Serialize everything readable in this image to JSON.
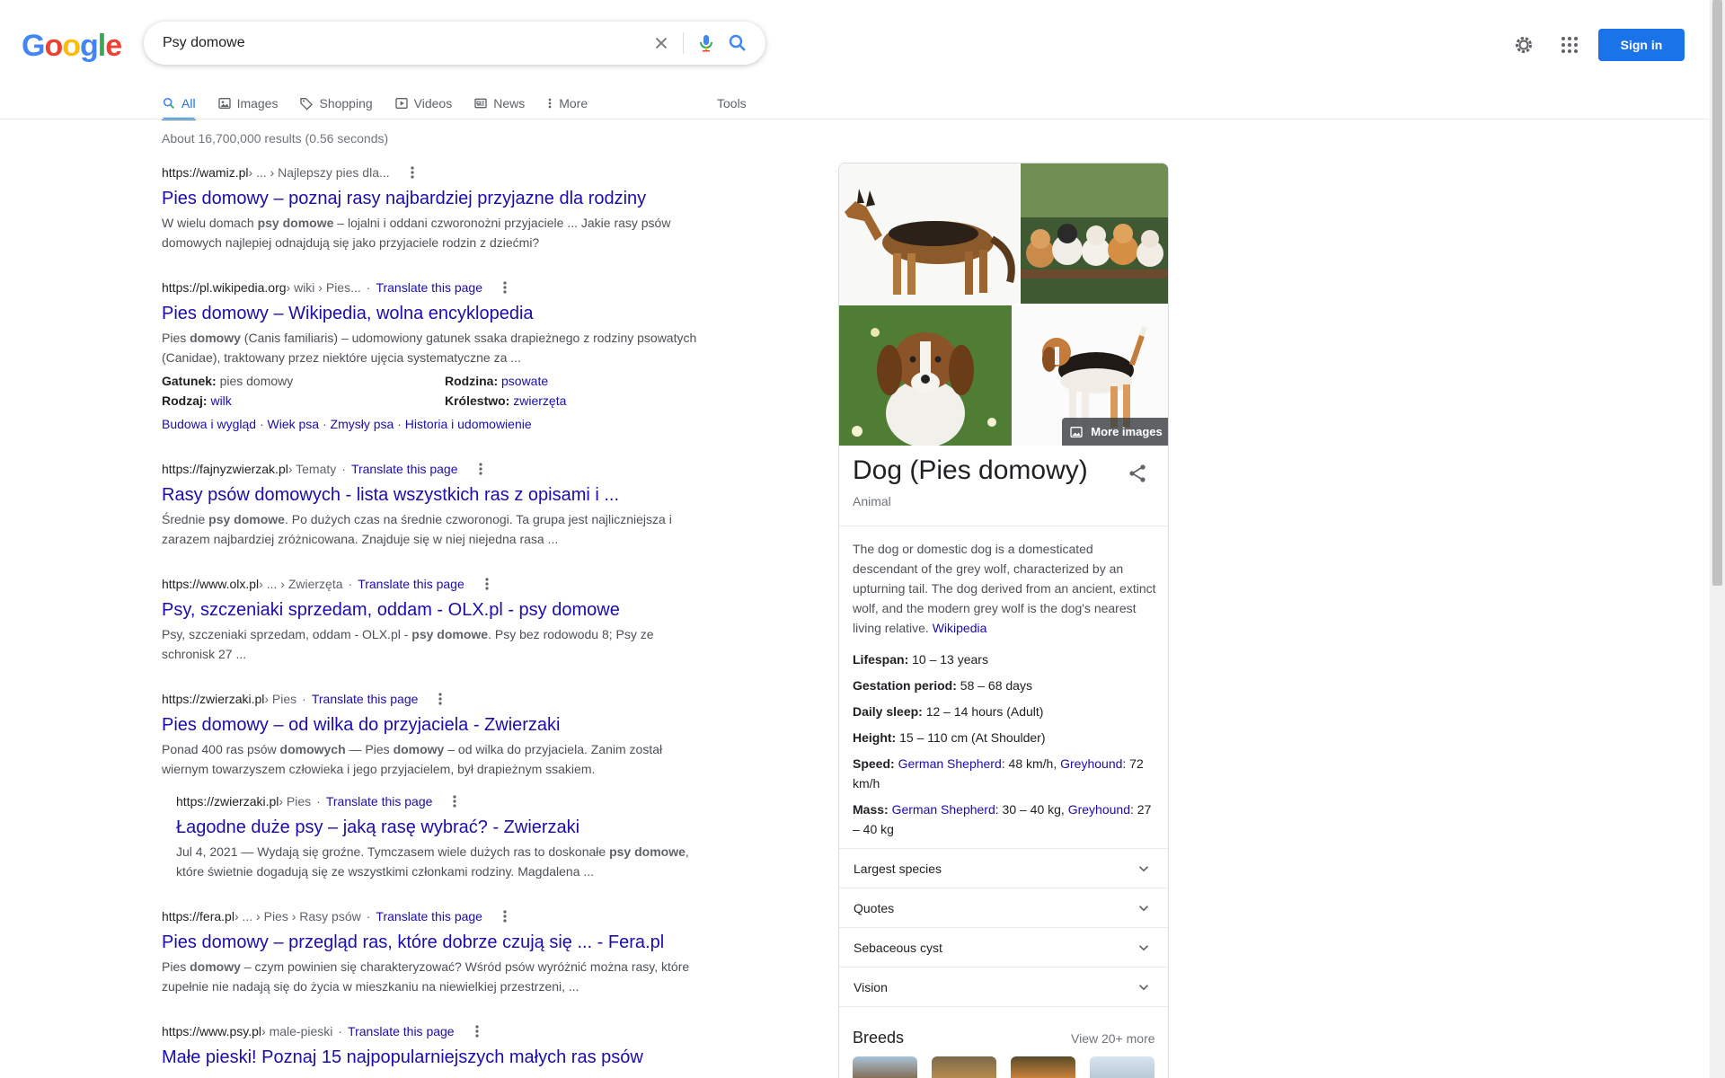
{
  "logo": {
    "letters": [
      "G",
      "o",
      "o",
      "g",
      "l",
      "e"
    ]
  },
  "search": {
    "query": "Psy domowe"
  },
  "header": {
    "sign_in": "Sign in"
  },
  "tabs": [
    {
      "label": "All",
      "icon": "search-icon",
      "active": true
    },
    {
      "label": "Images",
      "icon": "image-icon"
    },
    {
      "label": "Shopping",
      "icon": "tag-icon"
    },
    {
      "label": "Videos",
      "icon": "play-icon"
    },
    {
      "label": "News",
      "icon": "news-icon"
    },
    {
      "label": "More",
      "icon": "more-vert-icon"
    }
  ],
  "tools": "Tools",
  "stats": "About 16,700,000 results (0.56 seconds)",
  "results": [
    {
      "url": "https://wamiz.pl",
      "path": " › ... › Najlepszy pies dla...",
      "translate": "",
      "title": "Pies domowy – poznaj rasy najbardziej przyjazne dla rodziny",
      "snippet_parts": [
        "W wielu domach ",
        "psy domowe",
        " – lojalni i oddani czworonożni przyjaciele ... Jakie rasy psów domowych najlepiej odnajdują się jako przyjaciele rodzin z dziećmi?"
      ]
    },
    {
      "url": "https://pl.wikipedia.org",
      "path": " › wiki › Pies...",
      "translate": "Translate this page",
      "title": "Pies domowy – Wikipedia, wolna encyklopedia",
      "snippet_parts": [
        "Pies ",
        "domowy",
        " (Canis familiaris) – udomowiony gatunek ssaka drapieżnego z rodziny psowatych (Canidae), traktowany przez niektóre ujęcia systematyczne za ..."
      ],
      "attrs": [
        {
          "label": "Gatunek:",
          "value": "pies domowy",
          "link": false
        },
        {
          "label": "Rodzina:",
          "value": "psowate",
          "link": true
        },
        {
          "label": "Rodzaj:",
          "value": "wilk",
          "link": true
        },
        {
          "label": "Królestwo:",
          "value": "zwierzęta",
          "link": true
        }
      ],
      "sitelinks": [
        "Budowa i wygląd",
        "Wiek psa",
        "Zmysły psa",
        "Historia i udomowienie"
      ]
    },
    {
      "url": "https://fajnyzwierzak.pl",
      "path": " › Tematy",
      "translate": "Translate this page",
      "title": "Rasy psów domowych - lista wszystkich ras z opisami i ...",
      "snippet_parts": [
        "Średnie ",
        "psy domowe",
        ". Po dużych czas na średnie czworonogi. Ta grupa jest najliczniejsza i zarazem najbardziej zróżnicowana. Znajduje się w niej niejedna rasa ..."
      ]
    },
    {
      "url": "https://www.olx.pl",
      "path": " › ... › Zwierzęta",
      "translate": "Translate this page",
      "title": "Psy, szczeniaki sprzedam, oddam - OLX.pl - psy domowe",
      "snippet_parts": [
        "Psy, szczeniaki sprzedam, oddam - OLX.pl - ",
        "psy domowe",
        ". Psy bez rodowodu 8; Psy ze schronisk 27 ..."
      ]
    },
    {
      "url": "https://zwierzaki.pl",
      "path": " › Pies",
      "translate": "Translate this page",
      "title": "Pies domowy – od wilka do przyjaciela - Zwierzaki",
      "snippet_parts": [
        "Ponad 400 ras psów ",
        "domowych",
        " — Pies ",
        "domowy",
        " – od wilka do przyjaciela. Zanim został wiernym towarzyszem człowieka i jego przyjacielem, był drapieżnym ssakiem."
      ],
      "sub": {
        "url": "https://zwierzaki.pl",
        "path": " › Pies",
        "translate": "Translate this page",
        "title": "Łagodne duże psy – jaką rasę wybrać? - Zwierzaki",
        "snippet_parts": [
          "Jul 4, 2021 — Wydają się groźne. Tymczasem wiele dużych ras to doskonałe ",
          "psy domowe",
          ", które świetnie dogadują się ze wszystkimi członkami rodziny. Magdalena ..."
        ]
      }
    },
    {
      "url": "https://fera.pl",
      "path": " › ... › Pies › Rasy psów",
      "translate": "Translate this page",
      "title": "Pies domowy – przegląd ras, które dobrze czują się ... - Fera.pl",
      "snippet_parts": [
        "Pies ",
        "domowy",
        " – czym powinien się charakteryzować? Wśród psów wyróżnić można rasy, które zupełnie nie nadają się do życia w mieszkaniu na niewielkiej przestrzeni, ..."
      ]
    },
    {
      "url": "https://www.psy.pl",
      "path": " › male-pieski",
      "translate": "Translate this page",
      "title": "Małe pieski! Poznaj 15 najpopularniejszych małych ras psów",
      "snippet_parts": [
        "",
        "",
        ""
      ]
    }
  ],
  "knowledge_panel": {
    "more_images": "More images",
    "title": "Dog (Pies domowy)",
    "subtitle": "Animal",
    "description": "The dog or domestic dog is a domesticated descendant of the grey wolf, characterized by an upturning tail. The dog derived from an ancient, extinct wolf, and the modern grey wolf is the dog's nearest living relative. ",
    "description_link": "Wikipedia",
    "facts": {
      "lifespan_label": "Lifespan:",
      "lifespan": " 10 – 13 years",
      "gestation_label": "Gestation period:",
      "gestation": " 58 – 68 days",
      "sleep_label": "Daily sleep:",
      "sleep": " 12 – 14 hours (Adult)",
      "height_label": "Height:",
      "height": " 15 – 110 cm (At Shoulder)",
      "speed_label": "Speed:",
      "speed_l1": "German Shepherd",
      "speed_v1": ": 48 km/h, ",
      "speed_l2": "Greyhound",
      "speed_v2": ": 72 km/h",
      "mass_label": "Mass:",
      "mass_l1": "German Shepherd",
      "mass_v1": ": 30 – 40 kg, ",
      "mass_l2": "Greyhound",
      "mass_v2": ": 27 – 40 kg"
    },
    "accordions": [
      "Largest species",
      "Quotes",
      "Sebaceous cyst",
      "Vision"
    ],
    "breeds_title": "Breeds",
    "breeds_more": "View 20+ more"
  },
  "colors": {
    "link": "#1a0dab",
    "accent": "#1a73e8",
    "snippet": "#4d5156"
  }
}
